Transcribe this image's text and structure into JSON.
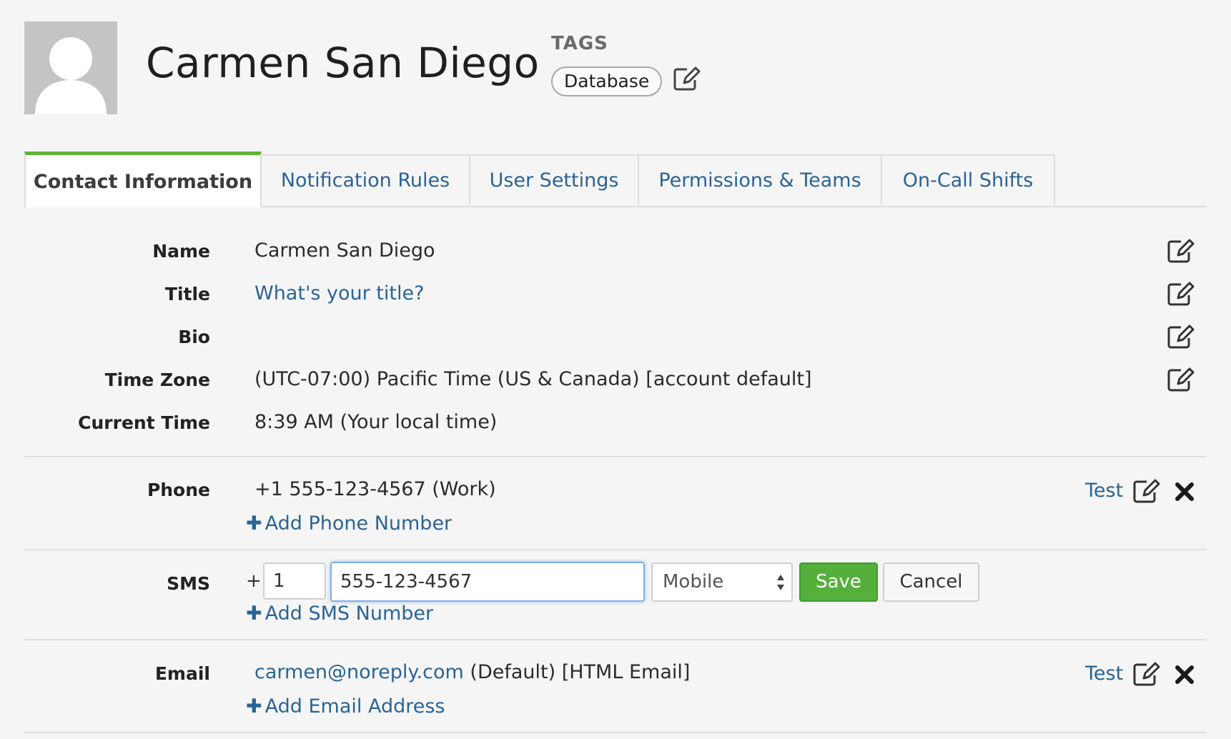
{
  "header": {
    "user_name": "Carmen San Diego",
    "tags_label": "TAGS",
    "tags": [
      "Database"
    ]
  },
  "tabs": [
    {
      "label": "Contact Information",
      "active": true
    },
    {
      "label": "Notification Rules",
      "active": false
    },
    {
      "label": "User Settings",
      "active": false
    },
    {
      "label": "Permissions & Teams",
      "active": false
    },
    {
      "label": "On-Call Shifts",
      "active": false
    }
  ],
  "profile": {
    "name_label": "Name",
    "name_value": "Carmen San Diego",
    "title_label": "Title",
    "title_placeholder": "What's your title?",
    "bio_label": "Bio",
    "bio_value": "",
    "timezone_label": "Time Zone",
    "timezone_value": "(UTC-07:00) Pacific Time (US & Canada) [account default]",
    "current_time_label": "Current Time",
    "current_time_value": "8:39 AM (Your local time)"
  },
  "phone": {
    "label": "Phone",
    "value": "+1 555-123-4567 (Work)",
    "test_label": "Test",
    "add_label": "Add Phone Number"
  },
  "sms": {
    "label": "SMS",
    "plus": "+",
    "country_code": "1",
    "number": "555-123-4567",
    "type_selected": "Mobile",
    "save_label": "Save",
    "cancel_label": "Cancel",
    "add_label": "Add SMS Number"
  },
  "email": {
    "label": "Email",
    "address": "carmen@noreply.com",
    "suffix": "(Default) [HTML Email]",
    "test_label": "Test",
    "add_label": "Add Email Address"
  },
  "colors": {
    "accent_green": "#5cb531",
    "link_blue": "#2a6496",
    "save_green": "#55b03b"
  }
}
